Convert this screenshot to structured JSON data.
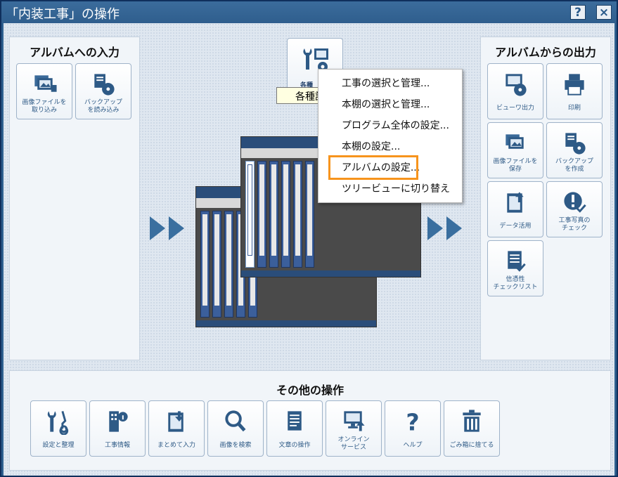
{
  "window": {
    "title": "「内装工事」の操作",
    "help_label": "?",
    "close_label": "×"
  },
  "left_panel": {
    "title": "アルバムへの入力",
    "tiles": [
      {
        "label": "画像ファイルを\n取り込み",
        "icon": "import-images-icon"
      },
      {
        "label": "バックアップ\nを読み込み",
        "icon": "load-backup-icon"
      }
    ]
  },
  "right_panel": {
    "title": "アルバムからの出力",
    "tiles": [
      {
        "label": "ビューワ出力",
        "icon": "viewer-output-icon"
      },
      {
        "label": "印刷",
        "icon": "printer-icon"
      },
      {
        "label": "画像ファイルを\n保存",
        "icon": "save-images-icon"
      },
      {
        "label": "バックアップ\nを作成",
        "icon": "create-backup-icon"
      },
      {
        "label": "データ活用",
        "icon": "data-use-icon"
      },
      {
        "label": "工事写真の\nチェック",
        "icon": "photo-check-icon"
      },
      {
        "label": "信憑性\nチェックリスト",
        "icon": "checklist-icon"
      }
    ]
  },
  "center": {
    "settings_tile": {
      "label": "各種",
      "icon": "settings-tools-icon"
    },
    "tooltip": "各種設定",
    "menu": [
      "工事の選択と管理...",
      "本棚の選択と管理...",
      "プログラム全体の設定...",
      "本棚の設定...",
      "アルバムの設定...",
      "ツリービューに切り替え"
    ],
    "highlighted_index": 4
  },
  "bottom_panel": {
    "title": "その他の操作",
    "tiles": [
      {
        "label": "設定と整理",
        "icon": "tools-icon"
      },
      {
        "label": "工事情報",
        "icon": "building-info-icon"
      },
      {
        "label": "まとめて入力",
        "icon": "bulk-input-icon"
      },
      {
        "label": "画像を検索",
        "icon": "search-icon"
      },
      {
        "label": "文章の操作",
        "icon": "document-icon"
      },
      {
        "label": "オンライン\nサービス",
        "icon": "online-service-icon"
      },
      {
        "label": "ヘルプ",
        "icon": "help-icon"
      },
      {
        "label": "ごみ箱に捨てる",
        "icon": "trash-icon"
      }
    ]
  },
  "colors": {
    "accent": "#2e5a86",
    "highlight": "#f7941d",
    "titlebar": "#2f5e8d"
  }
}
